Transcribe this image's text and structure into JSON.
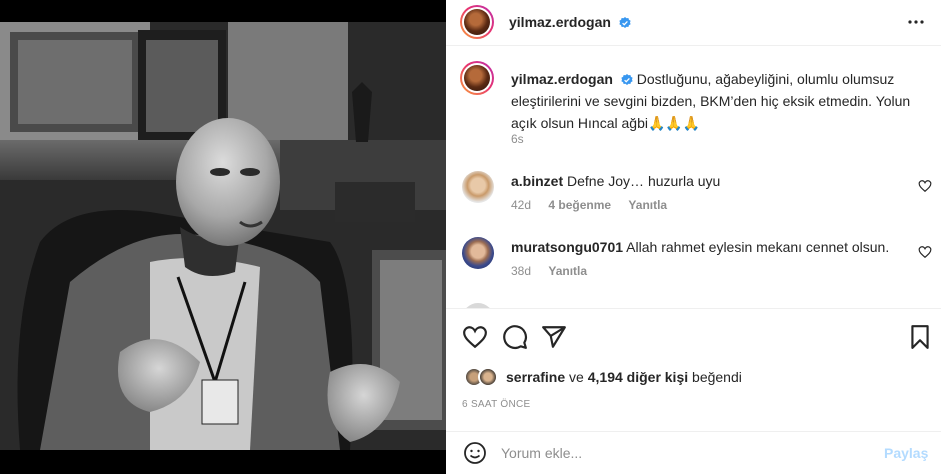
{
  "post": {
    "username": "yilmaz.erdogan",
    "verified": true,
    "photo_alt": "Black and white portrait photo"
  },
  "caption": {
    "username": "yilmaz.erdogan",
    "text": "Dostluğunu, ağabeyliğini, olumlu olumsuz eleştirilerini ve sevgini bizden, BKM’den hiç eksik etmedin. Yolun açık olsun Hıncal ağbi🙏🙏🙏",
    "time": "6s"
  },
  "comments": [
    {
      "username": "a.binzet",
      "text": "Defne Joy… huzurla uyu",
      "time": "42d",
      "likes": "4 beğenme",
      "reply": "Yanıtla"
    },
    {
      "username": "muratsongu0701",
      "text": "Allah rahmet eylesin mekanı cennet olsun.",
      "time": "38d",
      "likes": "",
      "reply": "Yanıtla"
    }
  ],
  "likes": {
    "first_user": "serrafine",
    "connector": "ve",
    "others": "4,194 diğer kişi",
    "suffix": "beğendi"
  },
  "posted_ago": "6 SAAT ÖNCE",
  "add_comment": {
    "placeholder": "Yorum ekle...",
    "post_label": "Paylaş"
  },
  "icons": {
    "verified": "verified-badge-icon",
    "more": "more-options-icon",
    "like": "heart-icon",
    "comment": "comment-icon",
    "share": "share-icon",
    "save": "bookmark-icon",
    "emoji": "emoji-icon"
  },
  "colors": {
    "verified": "#3897f0",
    "post_button_disabled": "#b3dbff",
    "muted_text": "#8e8e8e"
  }
}
